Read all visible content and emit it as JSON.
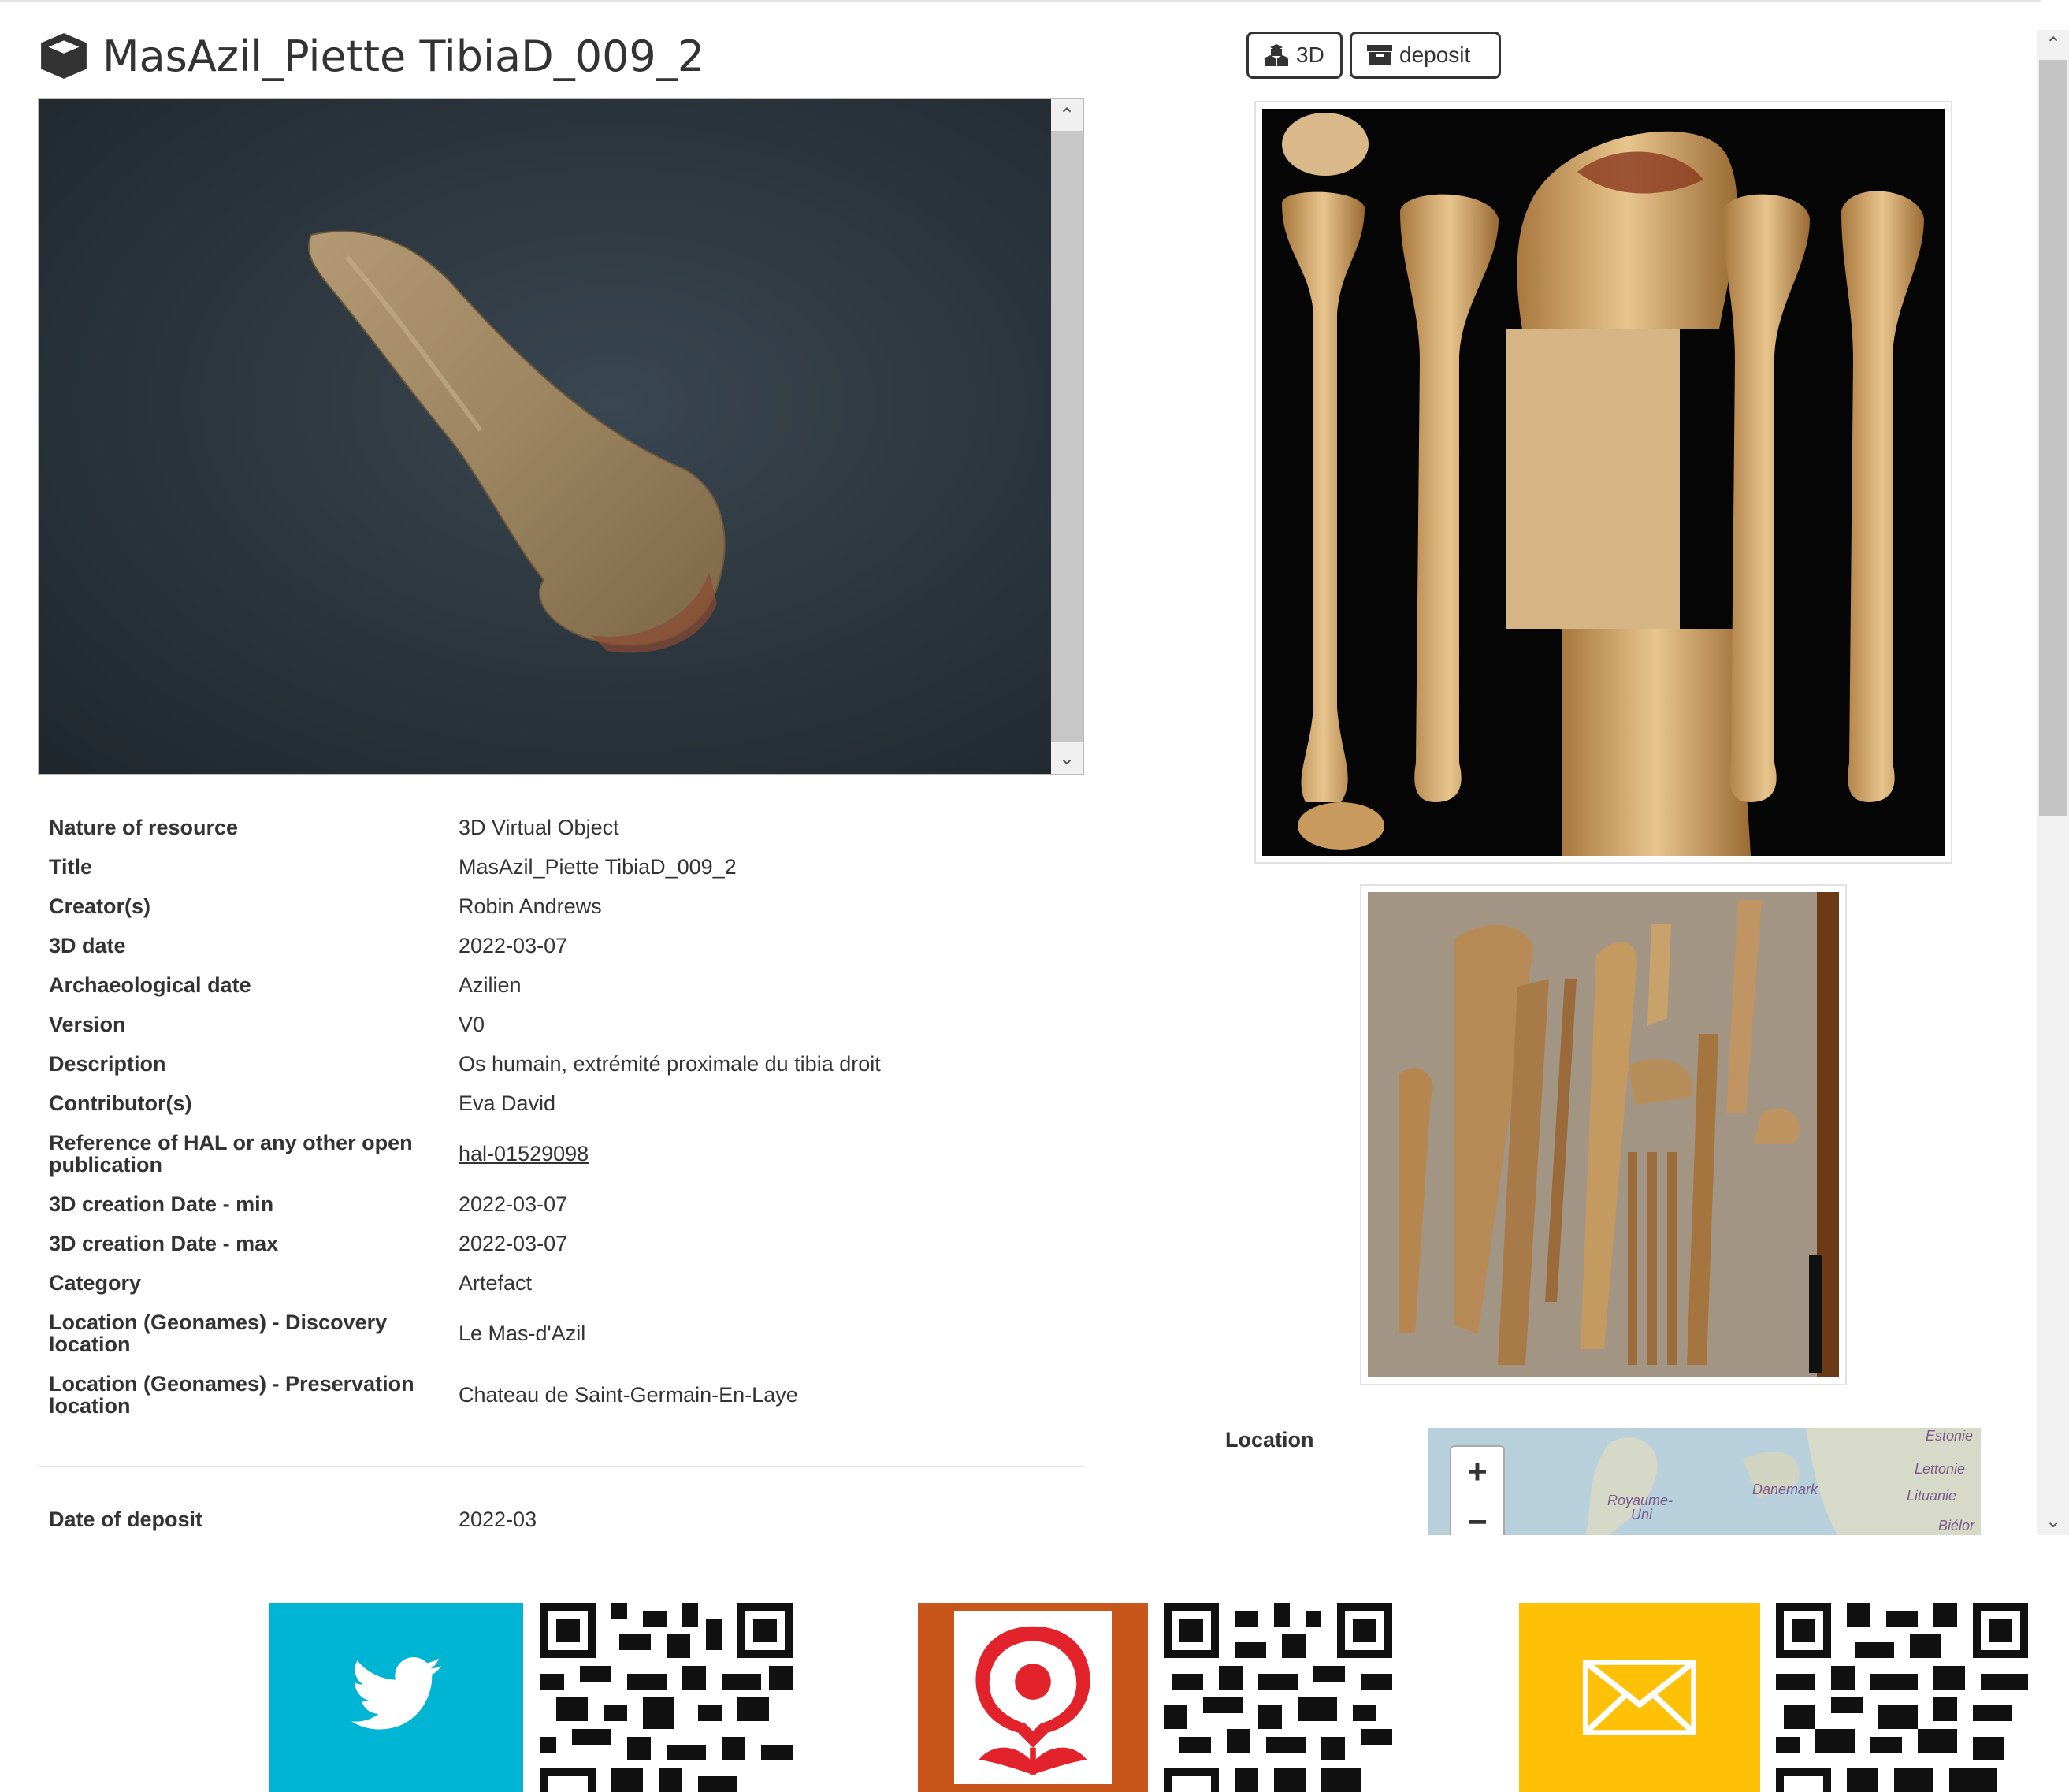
{
  "header": {
    "title": "MasAzil_Piette TibiaD_009_2",
    "btn_3d_label": "3D",
    "btn_deposit_label": "deposit"
  },
  "metadata": [
    {
      "key": "Nature of resource",
      "value": "3D Virtual Object"
    },
    {
      "key": "Title",
      "value": "MasAzil_Piette TibiaD_009_2"
    },
    {
      "key": "Creator(s)",
      "value": "Robin Andrews"
    },
    {
      "key": "3D date",
      "value": "2022-03-07"
    },
    {
      "key": "Archaeological date",
      "value": "Azilien"
    },
    {
      "key": "Version",
      "value": "V0"
    },
    {
      "key": "Description",
      "value": "Os humain, extrémité proximale du tibia droit"
    },
    {
      "key": "Contributor(s)",
      "value": "Eva David"
    },
    {
      "key": "Reference of HAL or any other open publication",
      "value": "hal-01529098"
    },
    {
      "key": "3D creation Date - min",
      "value": "2022-03-07"
    },
    {
      "key": "3D creation Date - max",
      "value": "2022-03-07"
    },
    {
      "key": "Category",
      "value": "Artefact"
    },
    {
      "key": "Location (Geonames) - Discovery location",
      "value": "Le Mas-d'Azil"
    },
    {
      "key": "Location (Geonames) - Preservation location",
      "value": "Chateau de Saint-Germain-En-Laye"
    }
  ],
  "deposit": {
    "key": "Date of deposit",
    "value": "2022-03"
  },
  "location": {
    "label": "Location",
    "zoom_in": "+",
    "zoom_out": "−",
    "map_labels": [
      "Estonie",
      "Lettonie",
      "Danemark",
      "Lituanie",
      "Royaume-",
      "Uni",
      "Biélor"
    ]
  },
  "colors": {
    "twitter": "#00b4d4",
    "hal": "#c8561a",
    "mail": "#ffc107"
  },
  "share": {
    "icons": [
      "twitter-icon",
      "hal-icon",
      "mail-icon"
    ]
  }
}
